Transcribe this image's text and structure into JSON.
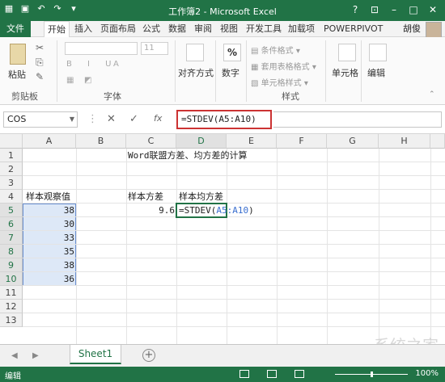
{
  "window": {
    "title": "工作簿2 - Microsoft Excel",
    "user": "胡俊"
  },
  "tabs": [
    {
      "label": "文件"
    },
    {
      "label": "开始"
    },
    {
      "label": "插入"
    },
    {
      "label": "页面布局"
    },
    {
      "label": "公式"
    },
    {
      "label": "数据"
    },
    {
      "label": "审阅"
    },
    {
      "label": "视图"
    },
    {
      "label": "开发工具"
    },
    {
      "label": "加载项"
    },
    {
      "label": "POWERPIVOT"
    }
  ],
  "ribbon": {
    "paste": "粘贴",
    "clipboard_group": "剪贴板",
    "font_group": "字体",
    "font_size": "11",
    "alignment": "对齐方式",
    "number": "数字",
    "conditional_format": "条件格式",
    "table_format": "套用表格格式",
    "cell_style": "单元格样式",
    "cells": "单元格",
    "editing": "编辑",
    "styles_group": "样式"
  },
  "formula_bar": {
    "name_box": "COS",
    "formula": "=STDEV(A5:A10)",
    "fx": "fx"
  },
  "grid": {
    "columns": [
      "A",
      "B",
      "C",
      "D",
      "E",
      "F",
      "G",
      "H"
    ],
    "rows": [
      "1",
      "2",
      "3",
      "4",
      "5",
      "6",
      "7",
      "8",
      "9",
      "10",
      "11",
      "12",
      "13"
    ],
    "title_cell": "Word联盟方差、均方差的计算",
    "a4": "样本观察值",
    "c4": "样本方差",
    "d4": "样本均方差",
    "values": [
      "38",
      "30",
      "33",
      "35",
      "38",
      "36"
    ],
    "c5": "9.6",
    "d5_prefix": "=STDEV(",
    "d5_ref": "A5:A10",
    "d5_suffix": ")"
  },
  "sheets": {
    "active": "Sheet1",
    "add": "+"
  },
  "status": {
    "mode": "编辑",
    "zoom": "100%",
    "zoom_level_percent": 100
  },
  "watermark": "系统之家"
}
